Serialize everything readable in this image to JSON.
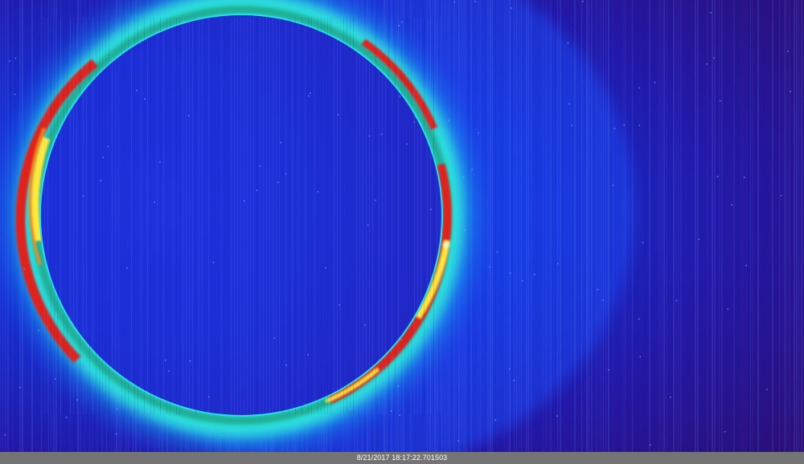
{
  "image": {
    "subject": "solar eclipse false-color image",
    "colors": {
      "background": "#2a0f7a",
      "field_blue": "#1440e6",
      "corona_cyan": "#2fe0d8",
      "corona_green": "#1fa88c",
      "prominence_red": "#e0241c",
      "prominence_yellow": "#ffe93a",
      "moon_disk": "#1f2fd8"
    }
  },
  "footer": {
    "timestamp": "8/21/2017 18:17:22.701503"
  }
}
